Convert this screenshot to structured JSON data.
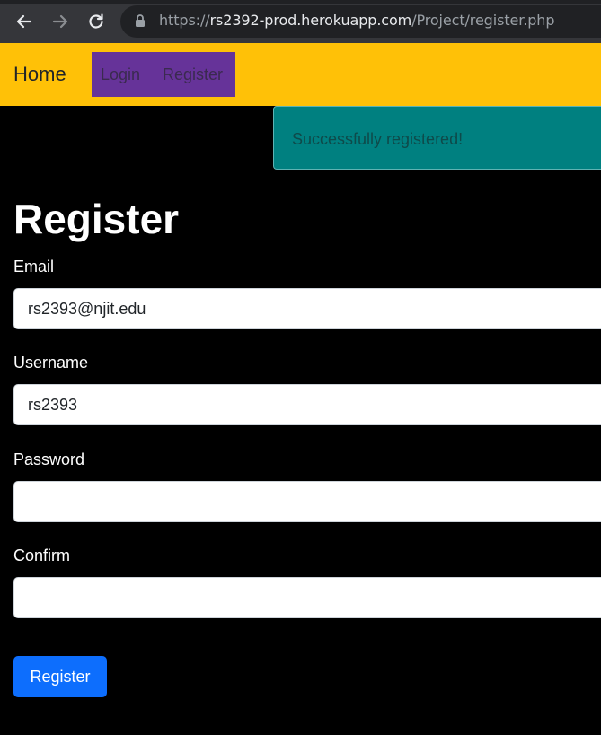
{
  "browser": {
    "url_prefix": "https://",
    "url_host": "rs2392-prod.herokuapp.com",
    "url_path": "/Project/register.php",
    "back_icon": "arrow-left-icon",
    "forward_icon": "arrow-right-icon",
    "reload_icon": "reload-icon",
    "lock_icon": "lock-icon"
  },
  "navbar": {
    "brand": "Home",
    "links": [
      {
        "label": "Login"
      },
      {
        "label": "Register"
      }
    ],
    "colors": {
      "bar": "#ffc107",
      "links_bg": "#663399"
    }
  },
  "alert": {
    "message": "Successfully registered!",
    "color": "#008080"
  },
  "form": {
    "title": "Register",
    "fields": [
      {
        "label": "Email",
        "value": "rs2393@njit.edu"
      },
      {
        "label": "Username",
        "value": "rs2393"
      },
      {
        "label": "Password",
        "value": ""
      },
      {
        "label": "Confirm",
        "value": ""
      }
    ],
    "submit_label": "Register",
    "submit_color": "#0d6efd"
  }
}
